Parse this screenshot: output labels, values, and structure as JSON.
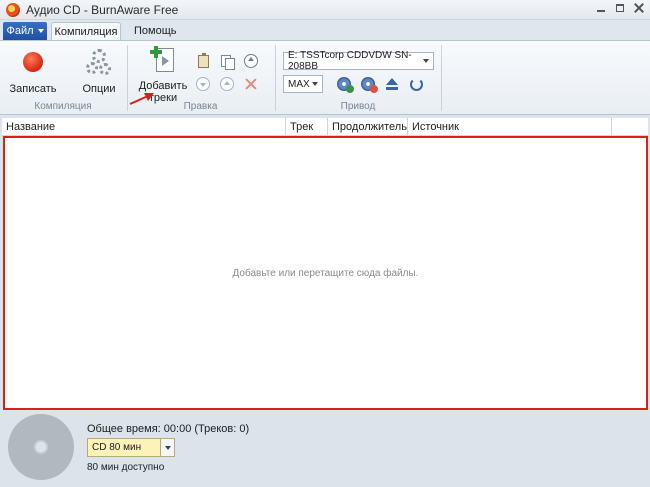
{
  "window": {
    "title": "Аудио CD - BurnAware Free"
  },
  "tabs": {
    "file_label": "Файл",
    "compilation": "Компиляция",
    "help": "Помощь"
  },
  "ribbon": {
    "compilation_group": {
      "label": "Компиляция",
      "burn": "Записать",
      "options": "Опции"
    },
    "edit_group": {
      "label": "Правка",
      "add_tracks_line1": "Добавить",
      "add_tracks_line2": "треки"
    },
    "drive_group": {
      "label": "Привод",
      "drive_value": "E: TSSTcorp CDDVDW SN-208BB",
      "speed_value": "MAX"
    }
  },
  "list": {
    "columns": [
      "Название",
      "Трек",
      "Продолжитель...",
      "Источник"
    ],
    "empty_message": "Добавьте или перетащите сюда файлы."
  },
  "footer": {
    "total_time": "Общее время: 00:00 (Треков: 0)",
    "disc_type": "CD 80 мин",
    "available": "80 мин доступно"
  },
  "colors": {
    "highlight_border": "#d62018",
    "file_tab": "#2b5cb3",
    "record": "#d92b14"
  }
}
